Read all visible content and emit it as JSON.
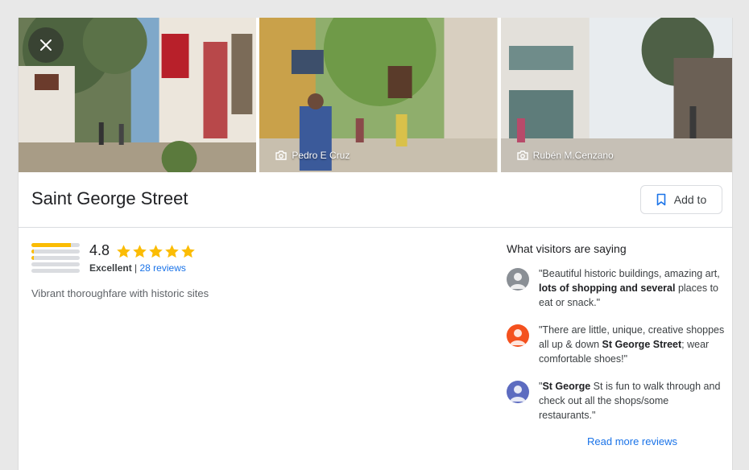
{
  "place": {
    "title": "Saint George Street",
    "add_label": "Add to",
    "rating": "4.8",
    "rating_value": 4.8,
    "rating_word": "Excellent",
    "reviews_link": "28 reviews",
    "description": "Vibrant thoroughfare with historic sites"
  },
  "photos": [
    {
      "credit": ""
    },
    {
      "credit": "Pedro E Cruz"
    },
    {
      "credit": "Rubén M.Cenzano"
    }
  ],
  "distribution": [
    0.82,
    0.05,
    0.05,
    0.0,
    0.0
  ],
  "visitors": {
    "title": "What visitors are saying",
    "read_more": "Read more reviews",
    "reviews": [
      {
        "pre": "\"Beautiful historic buildings, amazing art, ",
        "bold": "lots of shopping and several",
        "post": " places to eat or snack.\"",
        "avatar_color": "#8a8f95"
      },
      {
        "pre": "\"There are little, unique, creative shoppes all up & down ",
        "bold": "St George Street",
        "post": "; wear comfortable shoes!\"",
        "avatar_color": "#f4511e"
      },
      {
        "pre": "\"",
        "bold": "St George",
        "post": " St is fun to walk through and check out all the shops/some restaurants.\"",
        "avatar_color": "#5c6bc0"
      }
    ]
  },
  "colors": {
    "star": "#fbbc04",
    "link": "#1a73e8"
  }
}
